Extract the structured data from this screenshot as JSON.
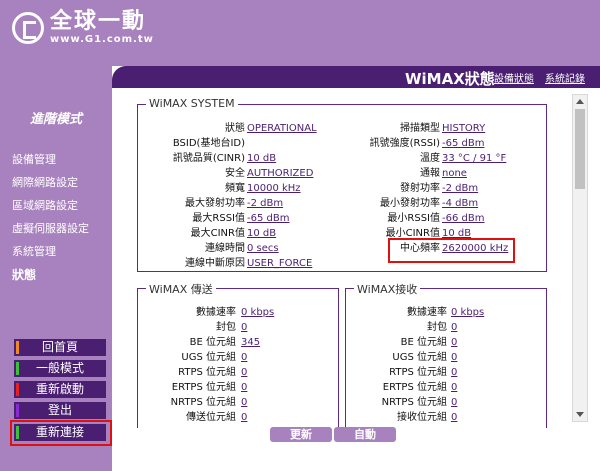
{
  "brand": {
    "title": "全球一動",
    "url": "www.G1.com.tw"
  },
  "sidebar": {
    "title": "進階模式",
    "items": [
      "設備管理",
      "網際網路設定",
      "區域網路設定",
      "虛擬伺服器設定",
      "系統管理",
      "狀態"
    ],
    "buttons": [
      "回首頁",
      "一般模式",
      "重新啟動",
      "登出",
      "重新連接"
    ]
  },
  "header": {
    "title": "WiMAX狀態",
    "links": [
      "設備狀態",
      "系統記錄"
    ]
  },
  "system": {
    "title": "WiMAX SYSTEM",
    "left": [
      {
        "label": "狀態",
        "value": "OPERATIONAL"
      },
      {
        "label": "BSID(基地台ID)",
        "value": ""
      },
      {
        "label": "訊號品質(CINR)",
        "value": "10 dB"
      },
      {
        "label": "安全",
        "value": "AUTHORIZED"
      },
      {
        "label": "頻寬",
        "value": "10000 kHz"
      },
      {
        "label": "最大發射功率",
        "value": "-2 dBm"
      },
      {
        "label": "最大RSSI值",
        "value": "-65 dBm"
      },
      {
        "label": "最大CINR值",
        "value": "10 dB"
      },
      {
        "label": "連線時間",
        "value": "0 secs"
      },
      {
        "label": "連線中斷原因",
        "value": "USER_FORCE"
      }
    ],
    "right": [
      {
        "label": "掃描類型",
        "value": "HISTORY"
      },
      {
        "label": "訊號強度(RSSI)",
        "value": "-65 dBm"
      },
      {
        "label": "溫度",
        "value": "33 °C / 91 °F"
      },
      {
        "label": "通報",
        "value": "none"
      },
      {
        "label": "發射功率",
        "value": "-2 dBm"
      },
      {
        "label": "最小發射功率",
        "value": "-4 dBm"
      },
      {
        "label": "最小RSSI值",
        "value": "-66 dBm"
      },
      {
        "label": "最小CINR值",
        "value": "10 dB"
      },
      {
        "label": "中心頻率",
        "value": "2620000 kHz"
      }
    ]
  },
  "tx": {
    "title": "WiMAX 傳送",
    "rows": [
      {
        "label": "數據速率",
        "value": "0 kbps"
      },
      {
        "label": "封包",
        "value": "0"
      },
      {
        "label": "BE 位元組",
        "value": "345"
      },
      {
        "label": "UGS 位元組",
        "value": "0"
      },
      {
        "label": "RTPS 位元組",
        "value": "0"
      },
      {
        "label": "ERTPS 位元組",
        "value": "0"
      },
      {
        "label": "NRTPS 位元組",
        "value": "0"
      },
      {
        "label": "傳送位元組",
        "value": "0"
      }
    ]
  },
  "rx": {
    "title": "WiMAX接收",
    "rows": [
      {
        "label": "數據速率",
        "value": "0 kbps"
      },
      {
        "label": "封包",
        "value": "0"
      },
      {
        "label": "BE 位元組",
        "value": "0"
      },
      {
        "label": "UGS 位元組",
        "value": "0"
      },
      {
        "label": "RTPS 位元組",
        "value": "0"
      },
      {
        "label": "ERTPS 位元組",
        "value": "0"
      },
      {
        "label": "NRTPS 位元組",
        "value": "0"
      },
      {
        "label": "接收位元組",
        "value": "0"
      }
    ]
  },
  "footer": {
    "refresh": "更新",
    "auto": "自動"
  },
  "colors": {
    "sidebar": "#a882be",
    "dark_purple": "#4a1f72",
    "highlight": "#e01010"
  }
}
